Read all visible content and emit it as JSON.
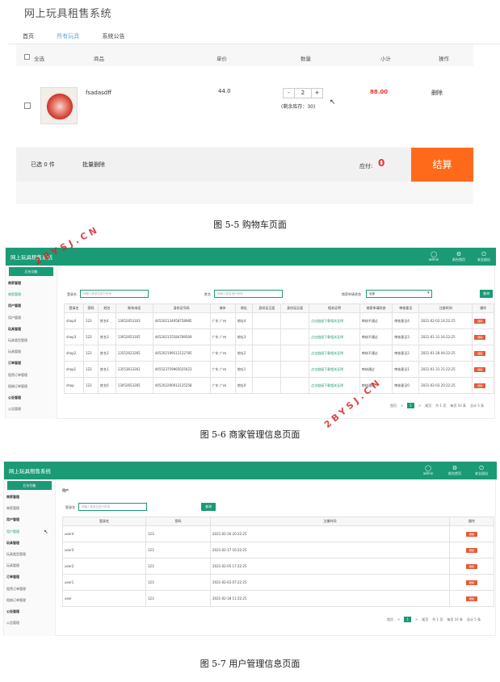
{
  "cart": {
    "app_title": "网上玩具租售系统",
    "nav": [
      "首页",
      "所有玩具",
      "系统公告"
    ],
    "columns": {
      "select_all": "全选",
      "product": "商品",
      "price": "单价",
      "quantity": "数量",
      "subtotal": "小计",
      "action": "操作"
    },
    "item": {
      "name": "fsadasdff",
      "price": "44.0",
      "qty_minus": "-",
      "qty": "2",
      "qty_plus": "+",
      "stock": "(剩余库存：30)",
      "subtotal": "88.00",
      "delete": "删除"
    },
    "footer": {
      "selected": "已选 0 件",
      "batch_delete": "批量删除",
      "payable_label": "应付:",
      "payable": "0",
      "checkout": "结算"
    }
  },
  "fig1_caption": "图 5-5 购物车页面",
  "admin_common": {
    "app_title": "网上玩具租售系统",
    "header_icons": [
      {
        "icon": "user-icon",
        "label": "admin"
      },
      {
        "icon": "home-icon",
        "label": "前台首页"
      },
      {
        "icon": "power-icon",
        "label": "安全退出"
      }
    ],
    "side_title": "后台功能"
  },
  "merchant": {
    "sidebar": [
      "商家管理",
      "商家管理",
      "用户管理",
      "用户管理",
      "玩具管理",
      "玩具类型管理",
      "玩具管理",
      "订单管理",
      "租赁订单管理",
      "租借订单管理",
      "公告管理",
      "公告管理"
    ],
    "search": {
      "label1": "登录名",
      "ph1": "请输入登录名进行查询",
      "label2": "姓名",
      "ph2": "请输入姓名进行查询",
      "label3": "商家申请状态",
      "select": "全部",
      "button": "查询"
    },
    "columns": [
      "登录名",
      "密码",
      "姓名",
      "联系电话",
      "身份证号码",
      "城市",
      "地址",
      "身份证正面",
      "身份证反面",
      "相关证明",
      "商家申请状态",
      "审核意见",
      "注册时间",
      "操作"
    ],
    "rows": [
      [
        "shop4",
        "123",
        "姓名4",
        "13052653163",
        "445202134958758985",
        "广东 广州",
        "地址4",
        "",
        "",
        "点击链接下载相关证明",
        "审核不通过",
        "审核意见4",
        "2021-02-03 14:22:25",
        "删除"
      ],
      [
        "shop3",
        "123",
        "姓名3",
        "13052653165",
        "445202155584789569",
        "广东 广州",
        "地址3",
        "",
        "",
        "点击链接下载相关证明",
        "审核不通过",
        "审核意见3",
        "2021-01-31 16:22:25",
        "删除"
      ],
      [
        "shop2",
        "123",
        "姓名2",
        "13552623265",
        "445202199512122785",
        "广东 广州",
        "地址2",
        "",
        "",
        "点击链接下载相关证明",
        "审核不通过",
        "审核意见2",
        "2021-01-28 04:22:25",
        "删除"
      ],
      [
        "shop1",
        "123",
        "姓名1",
        "13553613261",
        "445523759965025023",
        "广东 广州",
        "地址1",
        "",
        "",
        "点击链接下载相关证明",
        "审核通过",
        "审核意见1",
        "2021-01-31 21:22:25",
        "删除"
      ],
      [
        "shop",
        "123",
        "姓名0",
        "13052653265",
        "445202290012125258",
        "广东 广州",
        "地址0",
        "",
        "",
        "点击链接下载相关证明",
        "审核通过",
        "审核意见0",
        "2021-02-03 20:22:25",
        "删除"
      ]
    ],
    "pager": [
      "首页",
      "<",
      "1",
      ">",
      "尾页",
      "共 1 页",
      "每页 10 条",
      "总计 5 条"
    ],
    "watermark": "2BYSJ.CN"
  },
  "fig2_caption": "图 5-6 商家管理信息页面",
  "users": {
    "sidebar": [
      "商家管理",
      "商家管理",
      "用户管理",
      "用户管理",
      "玩具管理",
      "玩具类型管理",
      "玩具管理",
      "订单管理",
      "租赁订单管理",
      "租借订单管理",
      "公告管理",
      "公告管理"
    ],
    "breadcrumb": "用户",
    "search": {
      "label": "登录名",
      "placeholder": "请输入登录名进行查询",
      "button": "查询"
    },
    "columns": [
      "登录名",
      "密码",
      "注册时间",
      "操作"
    ],
    "rows": [
      [
        "user4",
        "123",
        "2021-02-16 20:22:25",
        "删除"
      ],
      [
        "user3",
        "123",
        "2021-02-17 16:22:25",
        "删除"
      ],
      [
        "user2",
        "123",
        "2021-02-05 17:22:25",
        "删除"
      ],
      [
        "user1",
        "123",
        "2021-02-03 07:22:25",
        "删除"
      ],
      [
        "user",
        "123",
        "2021-02-18 11:22:25",
        "删除"
      ]
    ],
    "pager": [
      "首页",
      "<",
      "1",
      ">",
      "尾页",
      "共 1 页",
      "每页 10 条",
      "总计 5 条"
    ]
  },
  "fig3_caption": "图 5-7 用户管理信息页面"
}
